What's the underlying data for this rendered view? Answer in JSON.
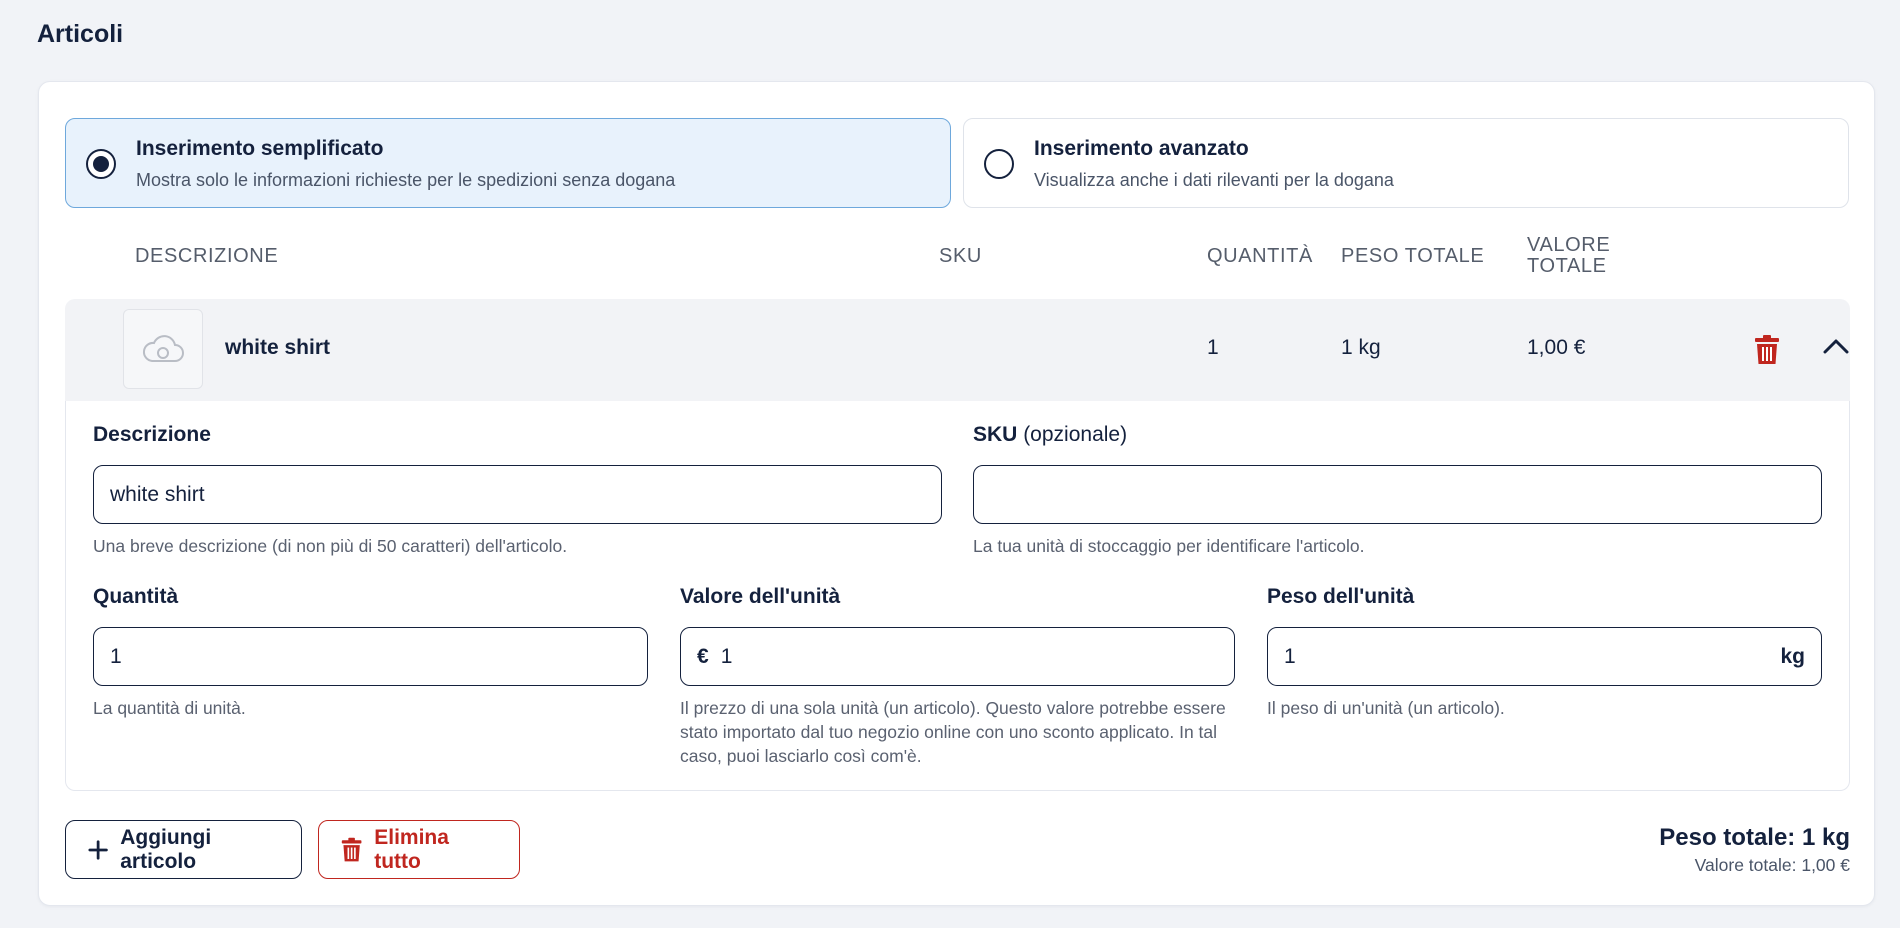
{
  "section": {
    "title": "Articoli"
  },
  "modes": {
    "simple": {
      "title": "Inserimento semplificato",
      "description": "Mostra solo le informazioni richieste per le spedizioni senza dogana",
      "selected": true
    },
    "advanced": {
      "title": "Inserimento avanzato",
      "description": "Visualizza anche i dati rilevanti per la dogana",
      "selected": false
    }
  },
  "table": {
    "headers": {
      "description": "DESCRIZIONE",
      "sku": "SKU",
      "quantity": "QUANTITÀ",
      "total_weight": "PESO TOTALE",
      "total_value_line1": "VALORE",
      "total_value_line2": "TOTALE"
    },
    "item": {
      "name": "white shirt",
      "sku": "",
      "quantity": "1",
      "total_weight": "1 kg",
      "total_value": "1,00 €",
      "image_icon": "cloud-image-placeholder-icon"
    }
  },
  "form": {
    "description": {
      "label": "Descrizione",
      "value": "white shirt",
      "help": "Una breve descrizione (di non più di 50 caratteri) dell'articolo."
    },
    "sku": {
      "label": "SKU",
      "label_optional": "(opzionale)",
      "value": "",
      "help": "La tua unità di stoccaggio per identificare l'articolo."
    },
    "quantity": {
      "label": "Quantità",
      "value": "1",
      "help": "La quantità di unità."
    },
    "unit_value": {
      "label": "Valore dell'unità",
      "prefix": "€",
      "value": "1",
      "help": "Il prezzo di una sola unità (un articolo). Questo valore potrebbe essere stato importato dal tuo negozio online con uno sconto applicato. In tal caso, puoi lasciarlo così com'è."
    },
    "unit_weight": {
      "label": "Peso dell'unità",
      "value": "1",
      "suffix": "kg",
      "help": "Il peso di un'unità (un articolo)."
    }
  },
  "actions": {
    "add_label": "Aggiungi articolo",
    "delete_all_label": "Elimina tutto"
  },
  "totals": {
    "weight": "Peso totale: 1 kg",
    "value": "Valore totale: 1,00 €"
  },
  "colors": {
    "primary": "#14213d",
    "danger": "#c0261f",
    "selected_bg": "#e8f2fc",
    "selected_border": "#6ea8dc"
  }
}
